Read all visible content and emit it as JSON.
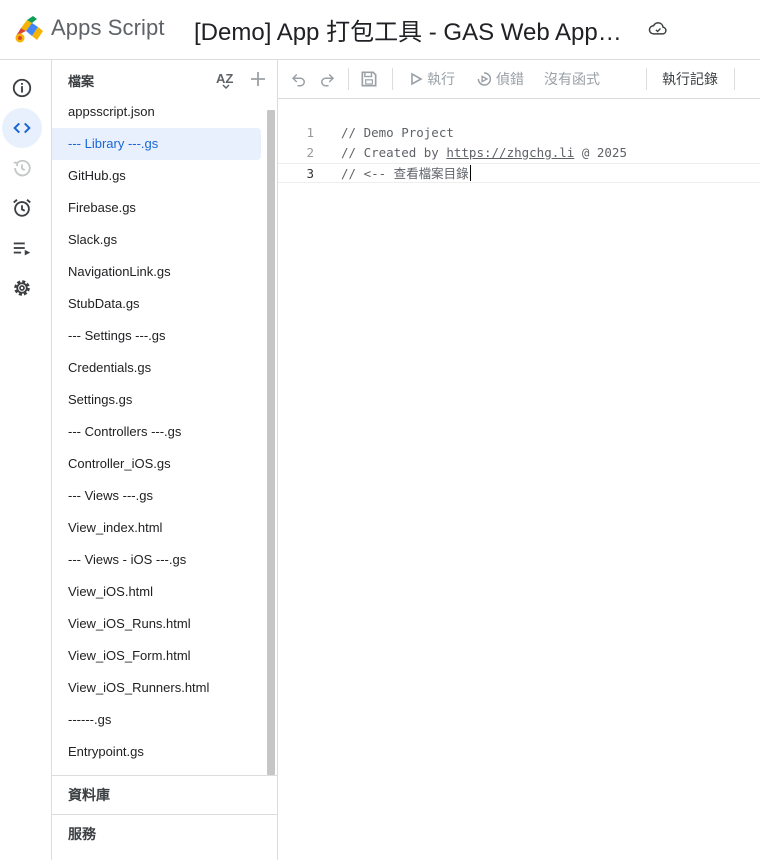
{
  "header": {
    "brand": "Apps Script",
    "project_title": "[Demo] App 打包工具 - GAS Web App…"
  },
  "rail": [
    {
      "name": "overview",
      "icon": "info-icon"
    },
    {
      "name": "editor",
      "icon": "code-icon",
      "active": true
    },
    {
      "name": "project-history",
      "icon": "history-icon"
    },
    {
      "name": "triggers",
      "icon": "alarm-icon"
    },
    {
      "name": "executions",
      "icon": "executions-list-icon"
    },
    {
      "name": "project-settings",
      "icon": "gear-icon"
    }
  ],
  "files": {
    "title": "檔案",
    "items": [
      "appsscript.json",
      "--- Library ---.gs",
      "GitHub.gs",
      "Firebase.gs",
      "Slack.gs",
      "NavigationLink.gs",
      "StubData.gs",
      "--- Settings ---.gs",
      "Credentials.gs",
      "Settings.gs",
      "--- Controllers ---.gs",
      "Controller_iOS.gs",
      "--- Views ---.gs",
      "View_index.html",
      "--- Views - iOS ---.gs",
      "View_iOS.html",
      "View_iOS_Runs.html",
      "View_iOS_Form.html",
      "View_iOS_Runners.html",
      "------.gs",
      "Entrypoint.gs"
    ],
    "selected_index": 1
  },
  "sections": {
    "libraries": "資料庫",
    "services": "服務"
  },
  "toolbar": {
    "run": "執行",
    "debug": "偵錯",
    "no_function": "沒有函式",
    "execution_log": "執行記錄"
  },
  "editor": {
    "lines": [
      {
        "num": "1",
        "prefix": "// Demo Project",
        "url": "",
        "suffix": ""
      },
      {
        "num": "2",
        "prefix": "// Created by ",
        "url": "https://zhgchg.li",
        "suffix": " @ 2025"
      },
      {
        "num": "3",
        "prefix": "// <-- 查看檔案目錄",
        "url": "",
        "suffix": ""
      }
    ],
    "current_line": 2
  },
  "colors": {
    "selected_bg": "#e8f0fe",
    "selected_text": "#1967d2",
    "border": "#dadce0",
    "disabled": "#9aa0a6"
  }
}
